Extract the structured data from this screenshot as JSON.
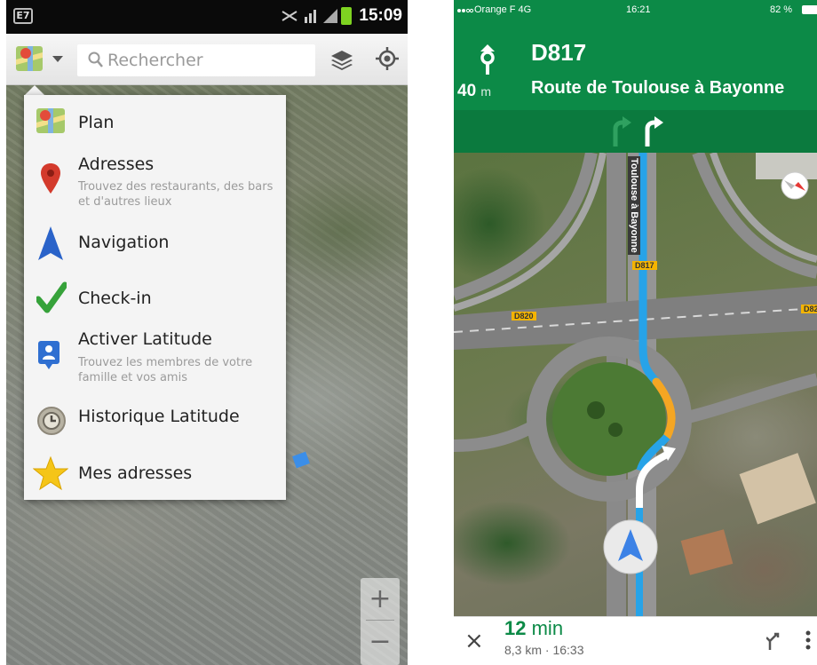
{
  "left_phone": {
    "status_bar": {
      "badge": "E7",
      "time": "15:09"
    },
    "search": {
      "placeholder": "Rechercher"
    },
    "menu": {
      "items": [
        {
          "title": "Plan",
          "subtitle": "",
          "icon": "map-icon"
        },
        {
          "title": "Adresses",
          "subtitle": "Trouvez des restaurants, des bars et d'autres lieux",
          "icon": "location-pin-icon"
        },
        {
          "title": "Navigation",
          "subtitle": "",
          "icon": "navigation-arrow-icon"
        },
        {
          "title": "Check-in",
          "subtitle": "",
          "icon": "checkmark-icon"
        },
        {
          "title": "Activer Latitude",
          "subtitle": "Trouvez les membres de votre famille et vos amis",
          "icon": "latitude-person-icon"
        },
        {
          "title": "Historique Latitude",
          "subtitle": "",
          "icon": "history-clock-icon"
        },
        {
          "title": "Mes adresses",
          "subtitle": "",
          "icon": "star-icon"
        }
      ]
    },
    "zoom": {
      "in": "+",
      "out": "−"
    }
  },
  "right_phone": {
    "status_bar": {
      "carrier": "Orange F  4G",
      "time": "16:21",
      "battery": "82 %"
    },
    "instruction": {
      "road": "D817",
      "distance": "40",
      "distance_unit": "m",
      "street": "Route de Toulouse à Bayonne"
    },
    "map_labels": {
      "road_vertical": "Toulouse à Bayonne",
      "shield_d817": "D817",
      "shield_d820": "D820",
      "shield_d82_edge": "D82"
    },
    "bottom": {
      "close": "×",
      "eta_value": "12",
      "eta_unit": "min",
      "details": "8,3 km · 16:33"
    },
    "colors": {
      "header": "#0c8a47",
      "route": "#27a3e8",
      "route_traffic": "#f5a623"
    }
  }
}
